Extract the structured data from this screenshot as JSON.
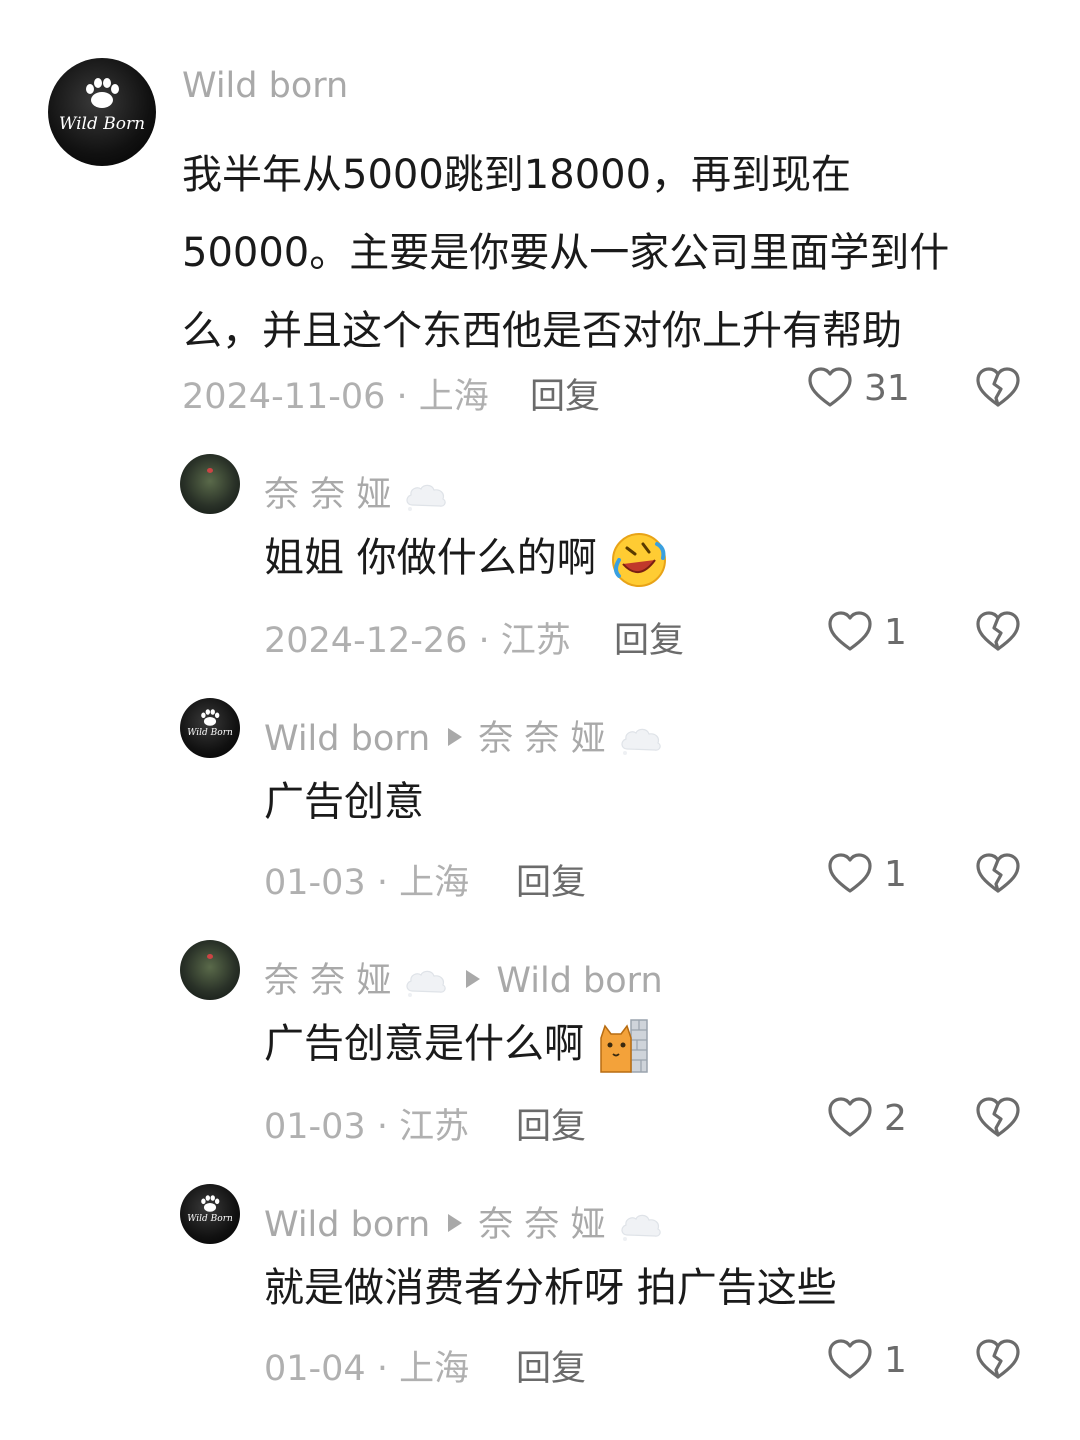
{
  "comments": [
    {
      "author": "Wild born",
      "avatar_text": "Wild Born",
      "text_line1": "我半年从5000跳到18000，再到现在",
      "text_line2": "50000。主要是你要从一家公司里面学到什",
      "text_line3": "么，并且这个东西他是否对你上升有帮助",
      "date": "2024-11-06 · 上海",
      "reply": "回复",
      "likes": "31"
    },
    {
      "author": "奈 奈 娅",
      "text": "姐姐 你做什么的啊",
      "emoji": "rolling-laughing-emoji",
      "date": "2024-12-26 · 江苏",
      "reply": "回复",
      "likes": "1"
    },
    {
      "author": "Wild born",
      "avatar_text": "Wild Born",
      "reply_to": "奈 奈 娅",
      "text": "广告创意",
      "date": "01-03 · 上海",
      "reply": "回复",
      "likes": "1"
    },
    {
      "author": "奈 奈 娅",
      "reply_to": "Wild born",
      "text": "广告创意是什么啊",
      "emoji": "cat-peeking-wall-emoji",
      "date": "01-03 · 江苏",
      "reply": "回复",
      "likes": "2"
    },
    {
      "author": "Wild born",
      "avatar_text": "Wild Born",
      "reply_to": "奈 奈 娅",
      "text": "就是做消费者分析呀 拍广告这些",
      "date": "01-04 · 上海",
      "reply": "回复",
      "likes": "1"
    }
  ],
  "icons": {
    "like": "heart-outline-icon",
    "dislike": "broken-heart-icon",
    "reply_arrow": "triangle-right-icon",
    "name_suffix": "thought-cloud-emoji"
  },
  "colors": {
    "background": "#ffffff",
    "author": "#a9a9a9",
    "body_text": "#1a1a1a",
    "meta": "#b0b0b0",
    "action": "#6b6b6b"
  }
}
